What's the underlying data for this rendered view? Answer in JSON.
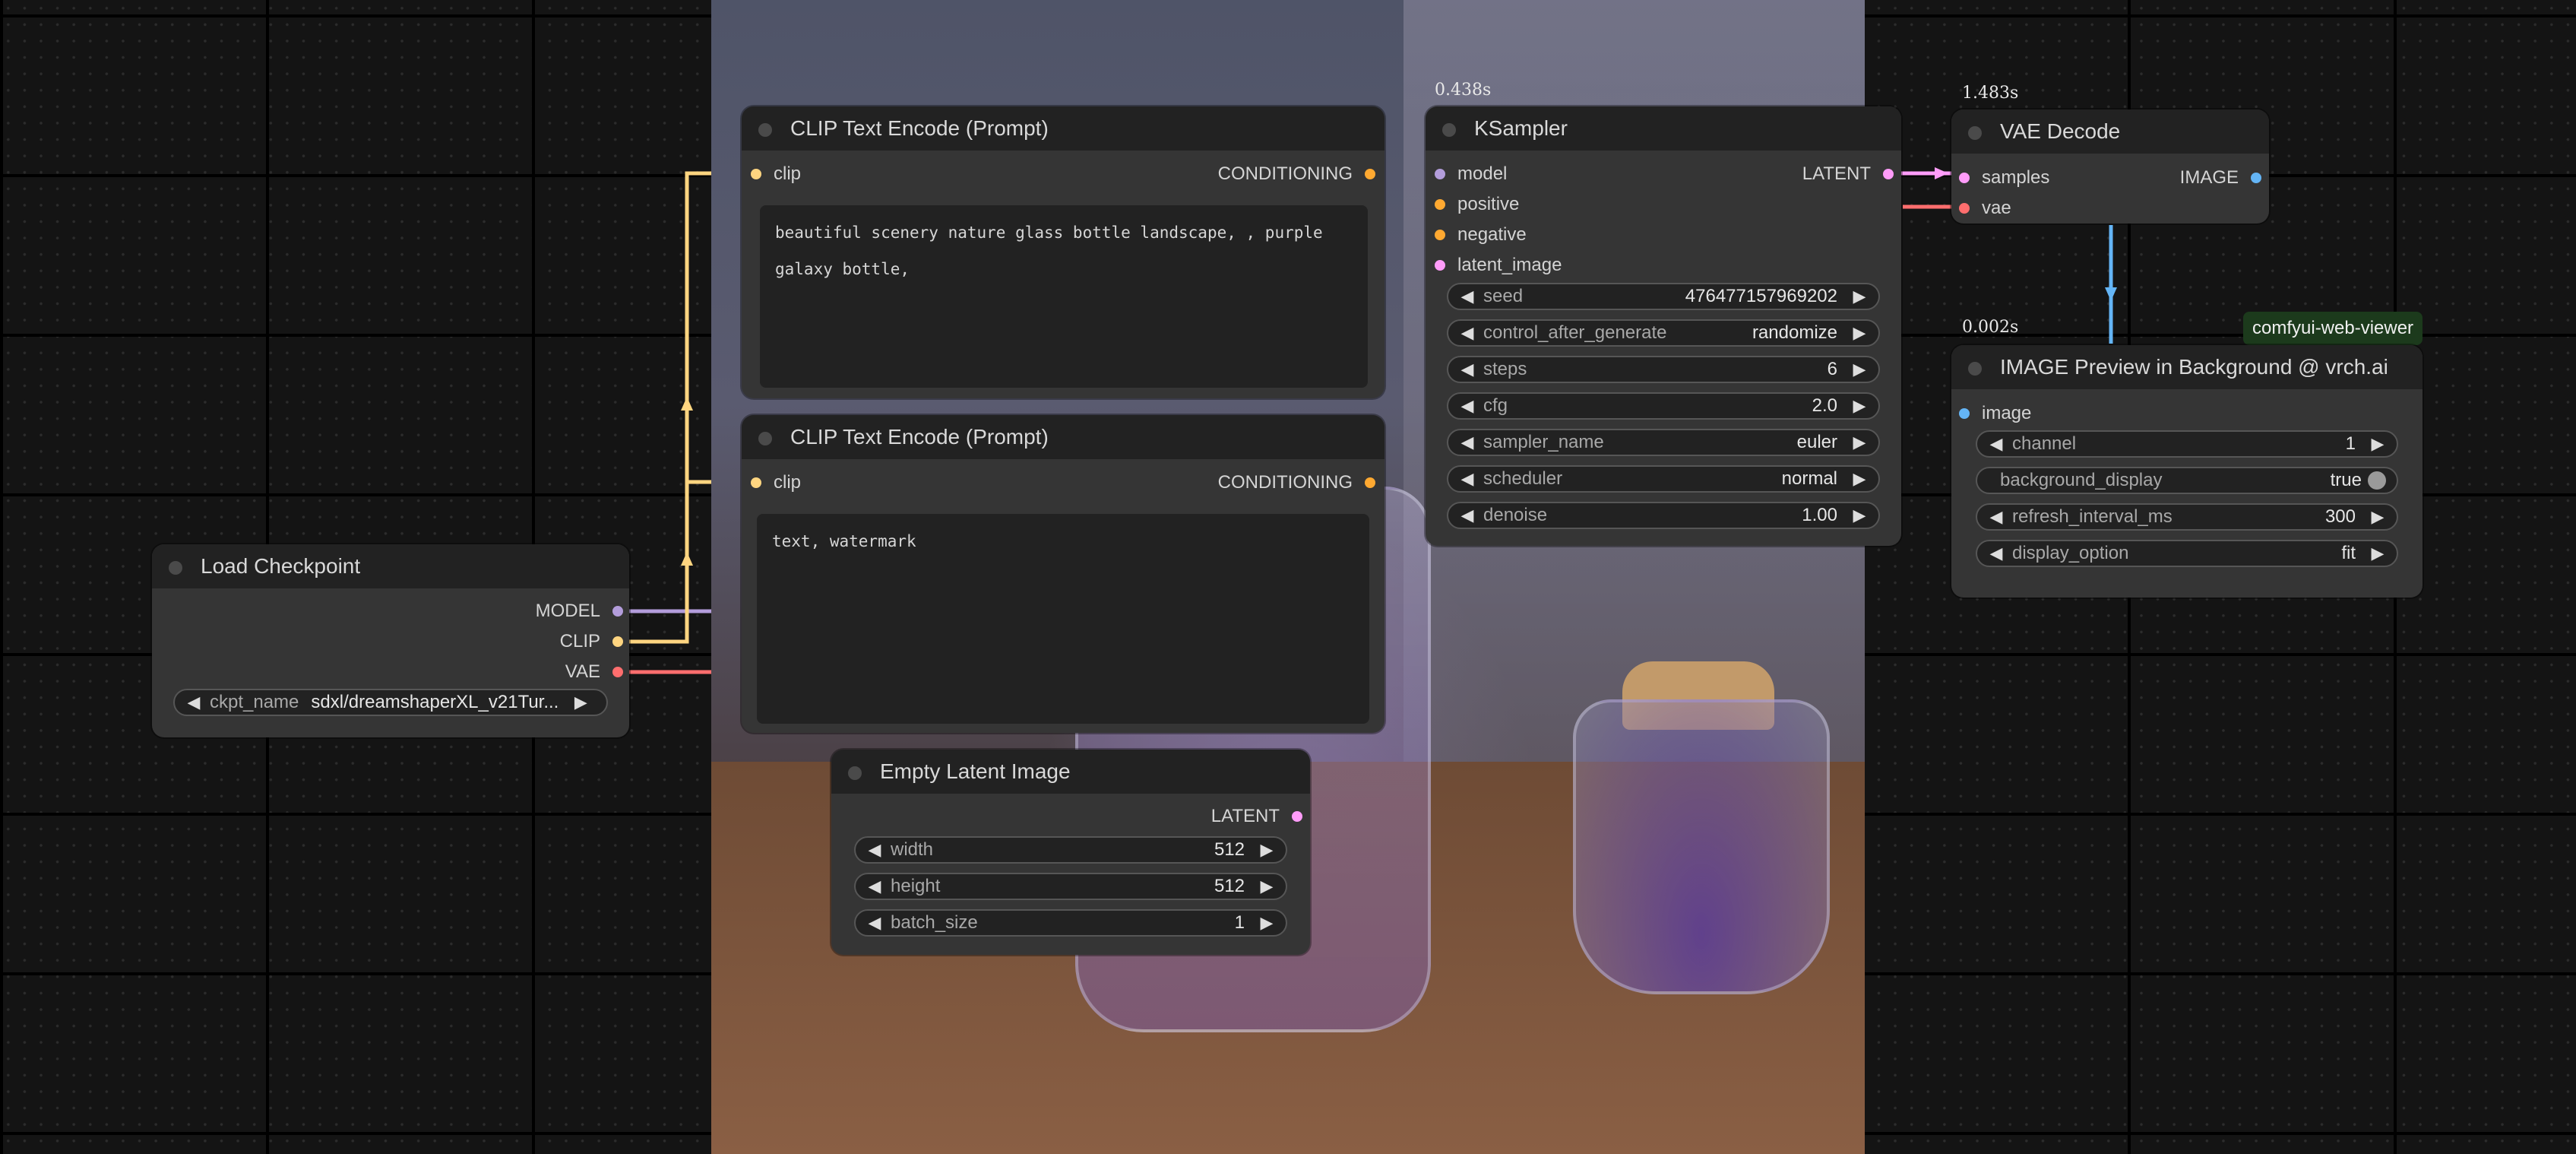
{
  "colors": {
    "model": "#b39ddb",
    "clip": "#ffd580",
    "vae": "#ff6e6e",
    "conditioning": "#ffa931",
    "latent": "#ff9cf9",
    "image": "#64b5f6"
  },
  "nodes": {
    "clip_encode_positive": {
      "title": "CLIP Text Encode (Prompt)",
      "input_clip": "clip",
      "output": "CONDITIONING",
      "text": "beautiful scenery nature glass bottle landscape, , purple galaxy bottle,"
    },
    "clip_encode_negative": {
      "title": "CLIP Text Encode (Prompt)",
      "input_clip": "clip",
      "output": "CONDITIONING",
      "text": "text, watermark"
    },
    "load_checkpoint": {
      "title": "Load Checkpoint",
      "outputs": [
        "MODEL",
        "CLIP",
        "VAE"
      ],
      "ckpt_label": "ckpt_name",
      "ckpt_value": "sdxl/dreamshaperXL_v21Tur..."
    },
    "empty_latent": {
      "title": "Empty Latent Image",
      "output": "LATENT",
      "widgets": [
        {
          "label": "width",
          "value": "512"
        },
        {
          "label": "height",
          "value": "512"
        },
        {
          "label": "batch_size",
          "value": "1"
        }
      ]
    },
    "ksampler": {
      "timing": "0.438s",
      "title": "KSampler",
      "inputs": [
        "model",
        "positive",
        "negative",
        "latent_image"
      ],
      "output": "LATENT",
      "widgets": [
        {
          "label": "seed",
          "value": "476477157969202"
        },
        {
          "label": "control_after_generate",
          "value": "randomize"
        },
        {
          "label": "steps",
          "value": "6"
        },
        {
          "label": "cfg",
          "value": "2.0"
        },
        {
          "label": "sampler_name",
          "value": "euler"
        },
        {
          "label": "scheduler",
          "value": "normal"
        },
        {
          "label": "denoise",
          "value": "1.00"
        }
      ]
    },
    "vae_decode": {
      "timing": "1.483s",
      "title": "VAE Decode",
      "inputs": [
        "samples",
        "vae"
      ],
      "output": "IMAGE"
    },
    "image_preview": {
      "timing": "0.002s",
      "badge": "comfyui-web-viewer",
      "title": "IMAGE Preview in Background @ vrch.ai",
      "input": "image",
      "widgets": [
        {
          "label": "channel",
          "value": "1"
        },
        {
          "label": "background_display",
          "value": "true"
        },
        {
          "label": "refresh_interval_ms",
          "value": "300"
        },
        {
          "label": "display_option",
          "value": "fit"
        }
      ]
    }
  }
}
